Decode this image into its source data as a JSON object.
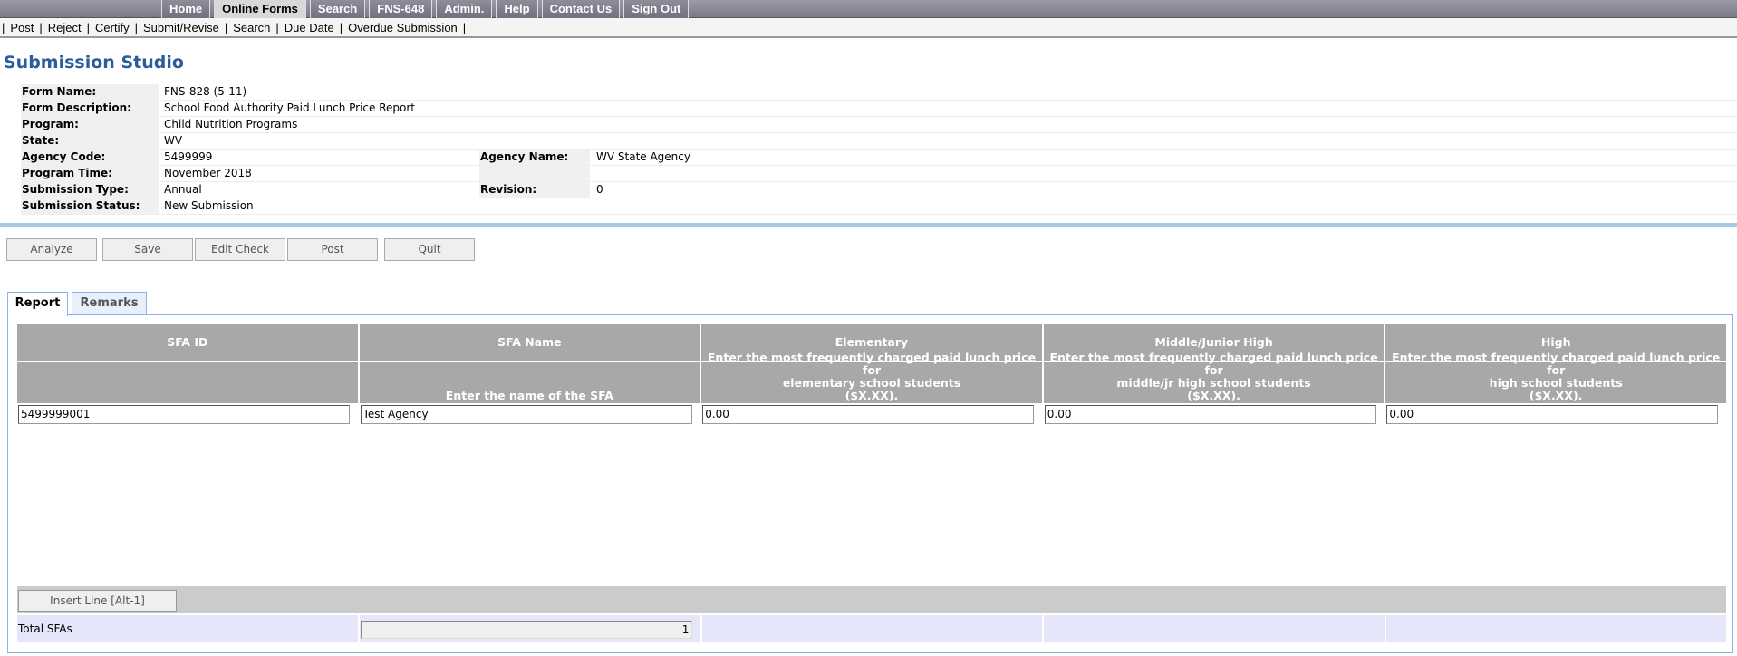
{
  "topnav": [
    "Home",
    "Online Forms",
    "Search",
    "FNS-648",
    "Admin.",
    "Help",
    "Contact Us",
    "Sign Out"
  ],
  "topnav_active": "Online Forms",
  "subnav": [
    "Post",
    "Reject",
    "Certify",
    "Submit/Revise",
    "Search",
    "Due Date",
    "Overdue Submission"
  ],
  "page_title": "Submission Studio",
  "info": {
    "form_name_label": "Form Name:",
    "form_name": "FNS-828 (5-11)",
    "form_desc_label": "Form Description:",
    "form_desc": "School Food Authority Paid Lunch Price Report",
    "program_label": "Program:",
    "program": "Child Nutrition Programs",
    "state_label": "State:",
    "state": "WV",
    "agency_code_label": "Agency Code:",
    "agency_code": "5499999",
    "agency_name_label": "Agency Name:",
    "agency_name": "WV State Agency",
    "program_time_label": "Program Time:",
    "program_time": "November 2018",
    "submission_type_label": "Submission Type:",
    "submission_type": "Annual",
    "revision_label": "Revision:",
    "revision": "0",
    "submission_status_label": "Submission Status:",
    "submission_status": "New Submission"
  },
  "actions": {
    "analyze": "Analyze",
    "save": "Save",
    "edit_check": "Edit Check",
    "post": "Post",
    "quit": "Quit"
  },
  "tabs": {
    "report": "Report",
    "remarks": "Remarks"
  },
  "grid": {
    "headers": [
      "SFA ID",
      "SFA Name",
      "Elementary",
      "Middle/Junior High",
      "High"
    ],
    "subheaders": [
      [],
      [
        "Enter the name of the SFA"
      ],
      [
        "Enter the most frequently charged paid lunch price for",
        "elementary school students",
        "($X.XX)."
      ],
      [
        "Enter the most frequently charged paid lunch price for",
        "middle/jr high school students",
        "($X.XX)."
      ],
      [
        "Enter the most frequently charged paid lunch price for",
        "high school students",
        "($X.XX)."
      ]
    ],
    "row": [
      "5499999001",
      "Test Agency",
      "0.00",
      "0.00",
      "0.00"
    ],
    "insert_line": "Insert Line [Alt-1]",
    "total_label": "Total SFAs",
    "total_value": "1"
  }
}
